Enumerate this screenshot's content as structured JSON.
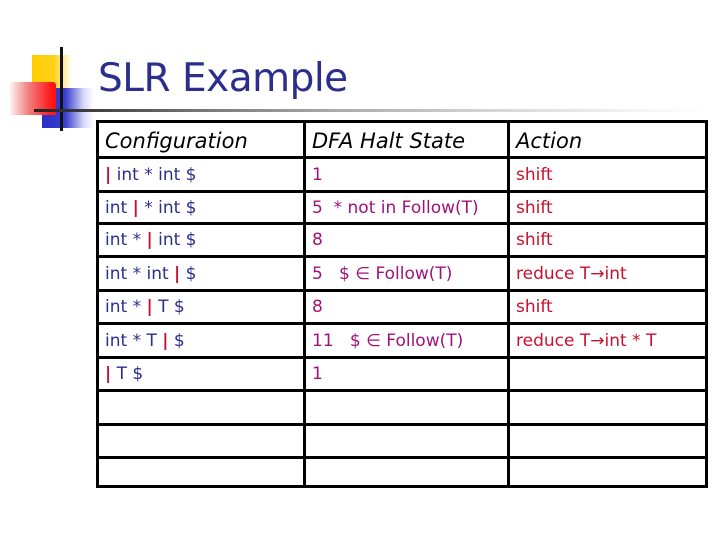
{
  "slide": {
    "title": "SLR Example"
  },
  "colors": {
    "title": "#2b2e8c",
    "configuration_text": "#2b2e8c",
    "cursor_bar": "#c8102e",
    "state_text": "#a0127a",
    "action_text": "#c8102e"
  },
  "table": {
    "headers": [
      "Configuration",
      "DFA Halt State",
      "Action"
    ],
    "rows": [
      {
        "config_before": "",
        "config_after": " int * int $",
        "state": "1",
        "action": "shift"
      },
      {
        "config_before": "int ",
        "config_after": " * int $",
        "state": "5  * not in Follow(T)",
        "action": "shift"
      },
      {
        "config_before": "int * ",
        "config_after": " int $",
        "state": "8",
        "action": "shift"
      },
      {
        "config_before": "int * int ",
        "config_after": " $",
        "state": "5   $ ∈ Follow(T)",
        "action": "reduce T→int"
      },
      {
        "config_before": "int * ",
        "config_after": " T $",
        "state": "8",
        "action": "shift"
      },
      {
        "config_before": "int * T ",
        "config_after": " $",
        "state": "11   $ ∈ Follow(T)",
        "action": "reduce T→int * T"
      },
      {
        "config_before": "",
        "config_after": " T $",
        "state": "1",
        "action": ""
      },
      {
        "config_before": "",
        "config_after": "",
        "state": "",
        "action": "",
        "empty": true
      },
      {
        "config_before": "",
        "config_after": "",
        "state": "",
        "action": "",
        "empty": true
      },
      {
        "config_before": "",
        "config_after": "",
        "state": "",
        "action": "",
        "empty": true
      }
    ],
    "cursor_symbol": "|"
  }
}
